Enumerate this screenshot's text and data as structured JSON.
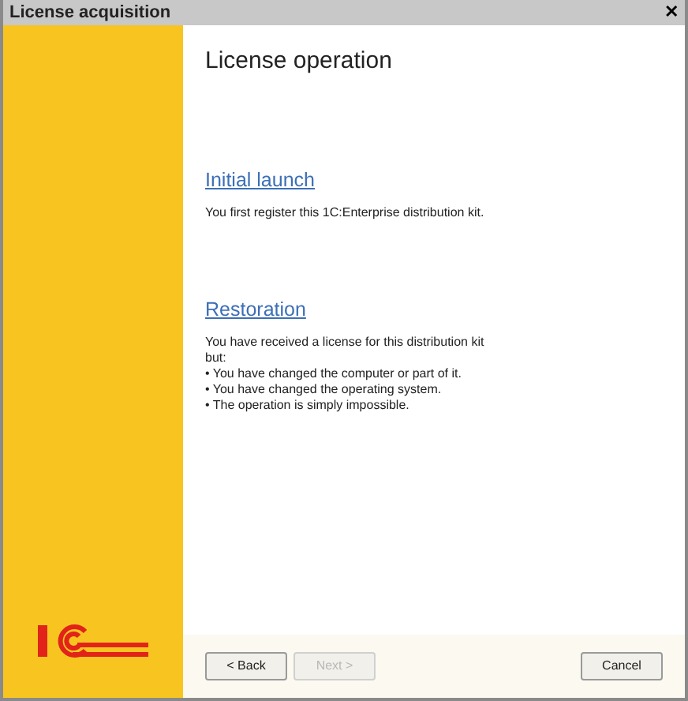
{
  "window": {
    "title": "License acquisition",
    "close": "✕"
  },
  "heading": "License operation",
  "options": [
    {
      "link": "Initial launch",
      "description": "You first register this 1C:Enterprise distribution kit."
    },
    {
      "link": "Restoration",
      "description": "You have received a license for this distribution kit but:",
      "bullets": [
        "• You have changed the computer or part of it.",
        "• You have changed the operating system.",
        "• The operation is simply impossible."
      ]
    }
  ],
  "buttons": [
    {
      "label": "< Back",
      "disabled": false
    },
    {
      "label": "Next >",
      "disabled": true
    }
  ],
  "cancel": {
    "label": "Cancel",
    "disabled": false
  }
}
